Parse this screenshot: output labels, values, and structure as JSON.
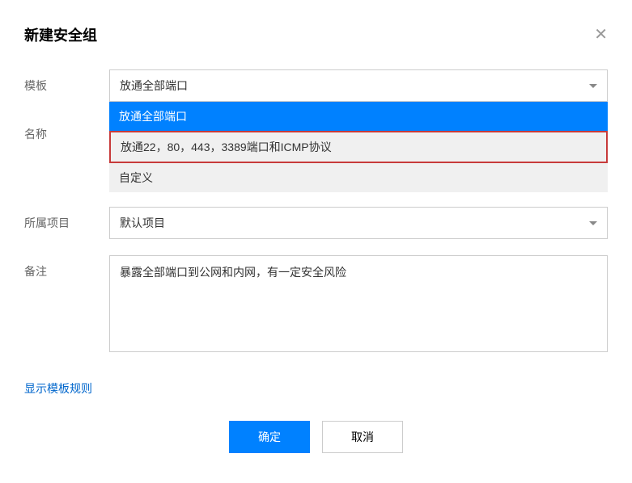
{
  "modal": {
    "title": "新建安全组"
  },
  "form": {
    "template": {
      "label": "模板",
      "selected": "放通全部端口",
      "options": [
        "放通全部端口",
        "放通22，80，443，3389端口和ICMP协议",
        "自定义"
      ]
    },
    "name": {
      "label": "名称"
    },
    "project": {
      "label": "所属项目",
      "selected": "默认项目"
    },
    "remark": {
      "label": "备注",
      "value": "暴露全部端口到公网和内网，有一定安全风险"
    }
  },
  "link": {
    "show_rules": "显示模板规则"
  },
  "buttons": {
    "confirm": "确定",
    "cancel": "取消"
  }
}
